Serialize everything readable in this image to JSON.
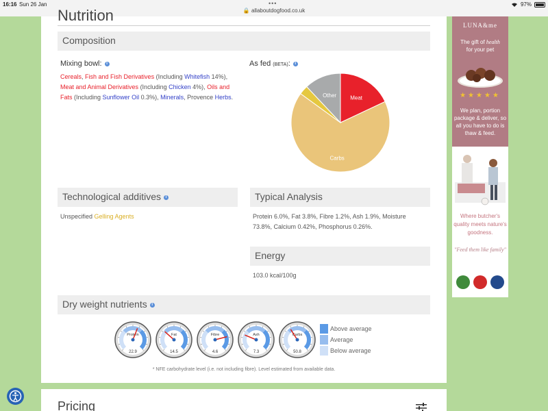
{
  "status_bar": {
    "time": "16:16",
    "date": "Sun 26 Jan",
    "url": "allaboutdogfood.co.uk",
    "battery": "97%"
  },
  "page": {
    "section_title": "Nutrition"
  },
  "composition": {
    "heading": "Composition",
    "mixing_bowl_label": "Mixing bowl:",
    "as_fed_label": "As fed",
    "as_fed_beta": "(BETA)",
    "text": {
      "cereals": "Cereals",
      "sep1": ", ",
      "fish": "Fish and Fish Derivatives",
      "incl1": " (Including ",
      "whitefish": "Whitefish",
      "pct1": " 14%),",
      "meat": "Meat and Animal Derivatives",
      "incl2": " (Including ",
      "chicken": "Chicken",
      "pct2": " 4%), ",
      "oils": "Oils and Fats",
      "incl3": " (Including ",
      "sunflower": "Sunflower Oil",
      "pct3": " 0.3%), ",
      "minerals": "Minerals",
      "provence": ", Provence ",
      "herbs": "Herbs",
      "end": "."
    }
  },
  "chart_data": {
    "type": "pie",
    "slices": [
      {
        "label": "Meat",
        "value": 18,
        "color": "#e8212b"
      },
      {
        "label": "Carbs",
        "value": 67,
        "color": "#eac57a"
      },
      {
        "label": "",
        "value": 3,
        "color": "#e5c840"
      },
      {
        "label": "Other",
        "value": 12,
        "color": "#a8aaab"
      }
    ]
  },
  "tech_additives": {
    "heading": "Technological additives",
    "prefix": "Unspecified ",
    "highlight": "Gelling Agents"
  },
  "typical_analysis": {
    "heading": "Typical Analysis",
    "text": "Protein 6.0%, Fat 3.8%, Fibre 1.2%, Ash 1.9%, Moisture 73.8%, Calcium 0.42%, Phosphorus 0.26%."
  },
  "energy": {
    "heading": "Energy",
    "value": "103.0 kcal/100g"
  },
  "dry_weight": {
    "heading": "Dry weight nutrients",
    "gauges": [
      {
        "label": "Protein",
        "value": "22.9",
        "needle": 0.58
      },
      {
        "label": "Fat",
        "value": "14.5",
        "needle": 0.32
      },
      {
        "label": "Fibre",
        "value": "4.6",
        "needle": 0.78
      },
      {
        "label": "Ash",
        "value": "7.3",
        "needle": 0.25
      },
      {
        "label": "Carbs",
        "value": "50.8",
        "needle": 0.38
      }
    ],
    "legend": [
      {
        "label": "Above average",
        "color": "#5b9ae5"
      },
      {
        "label": "Average",
        "color": "#97bdee"
      },
      {
        "label": "Below average",
        "color": "#cfe0f7"
      }
    ],
    "footnote": "* NFE carbohydrate level (i.e. not including fibre). Level estimated from available data."
  },
  "pricing": {
    "heading": "Pricing"
  },
  "ad": {
    "logo": "LUNA&me",
    "tagline_1": "The gift of",
    "tagline_health": "health",
    "tagline_2": "for your pet",
    "stars": "★★★★★",
    "copy": "We plan, portion package & deliver, so all you have to do is thaw & feed.",
    "quality": "Where butcher's quality meets nature's goodness.",
    "quote": "\"Feed them like family\""
  }
}
